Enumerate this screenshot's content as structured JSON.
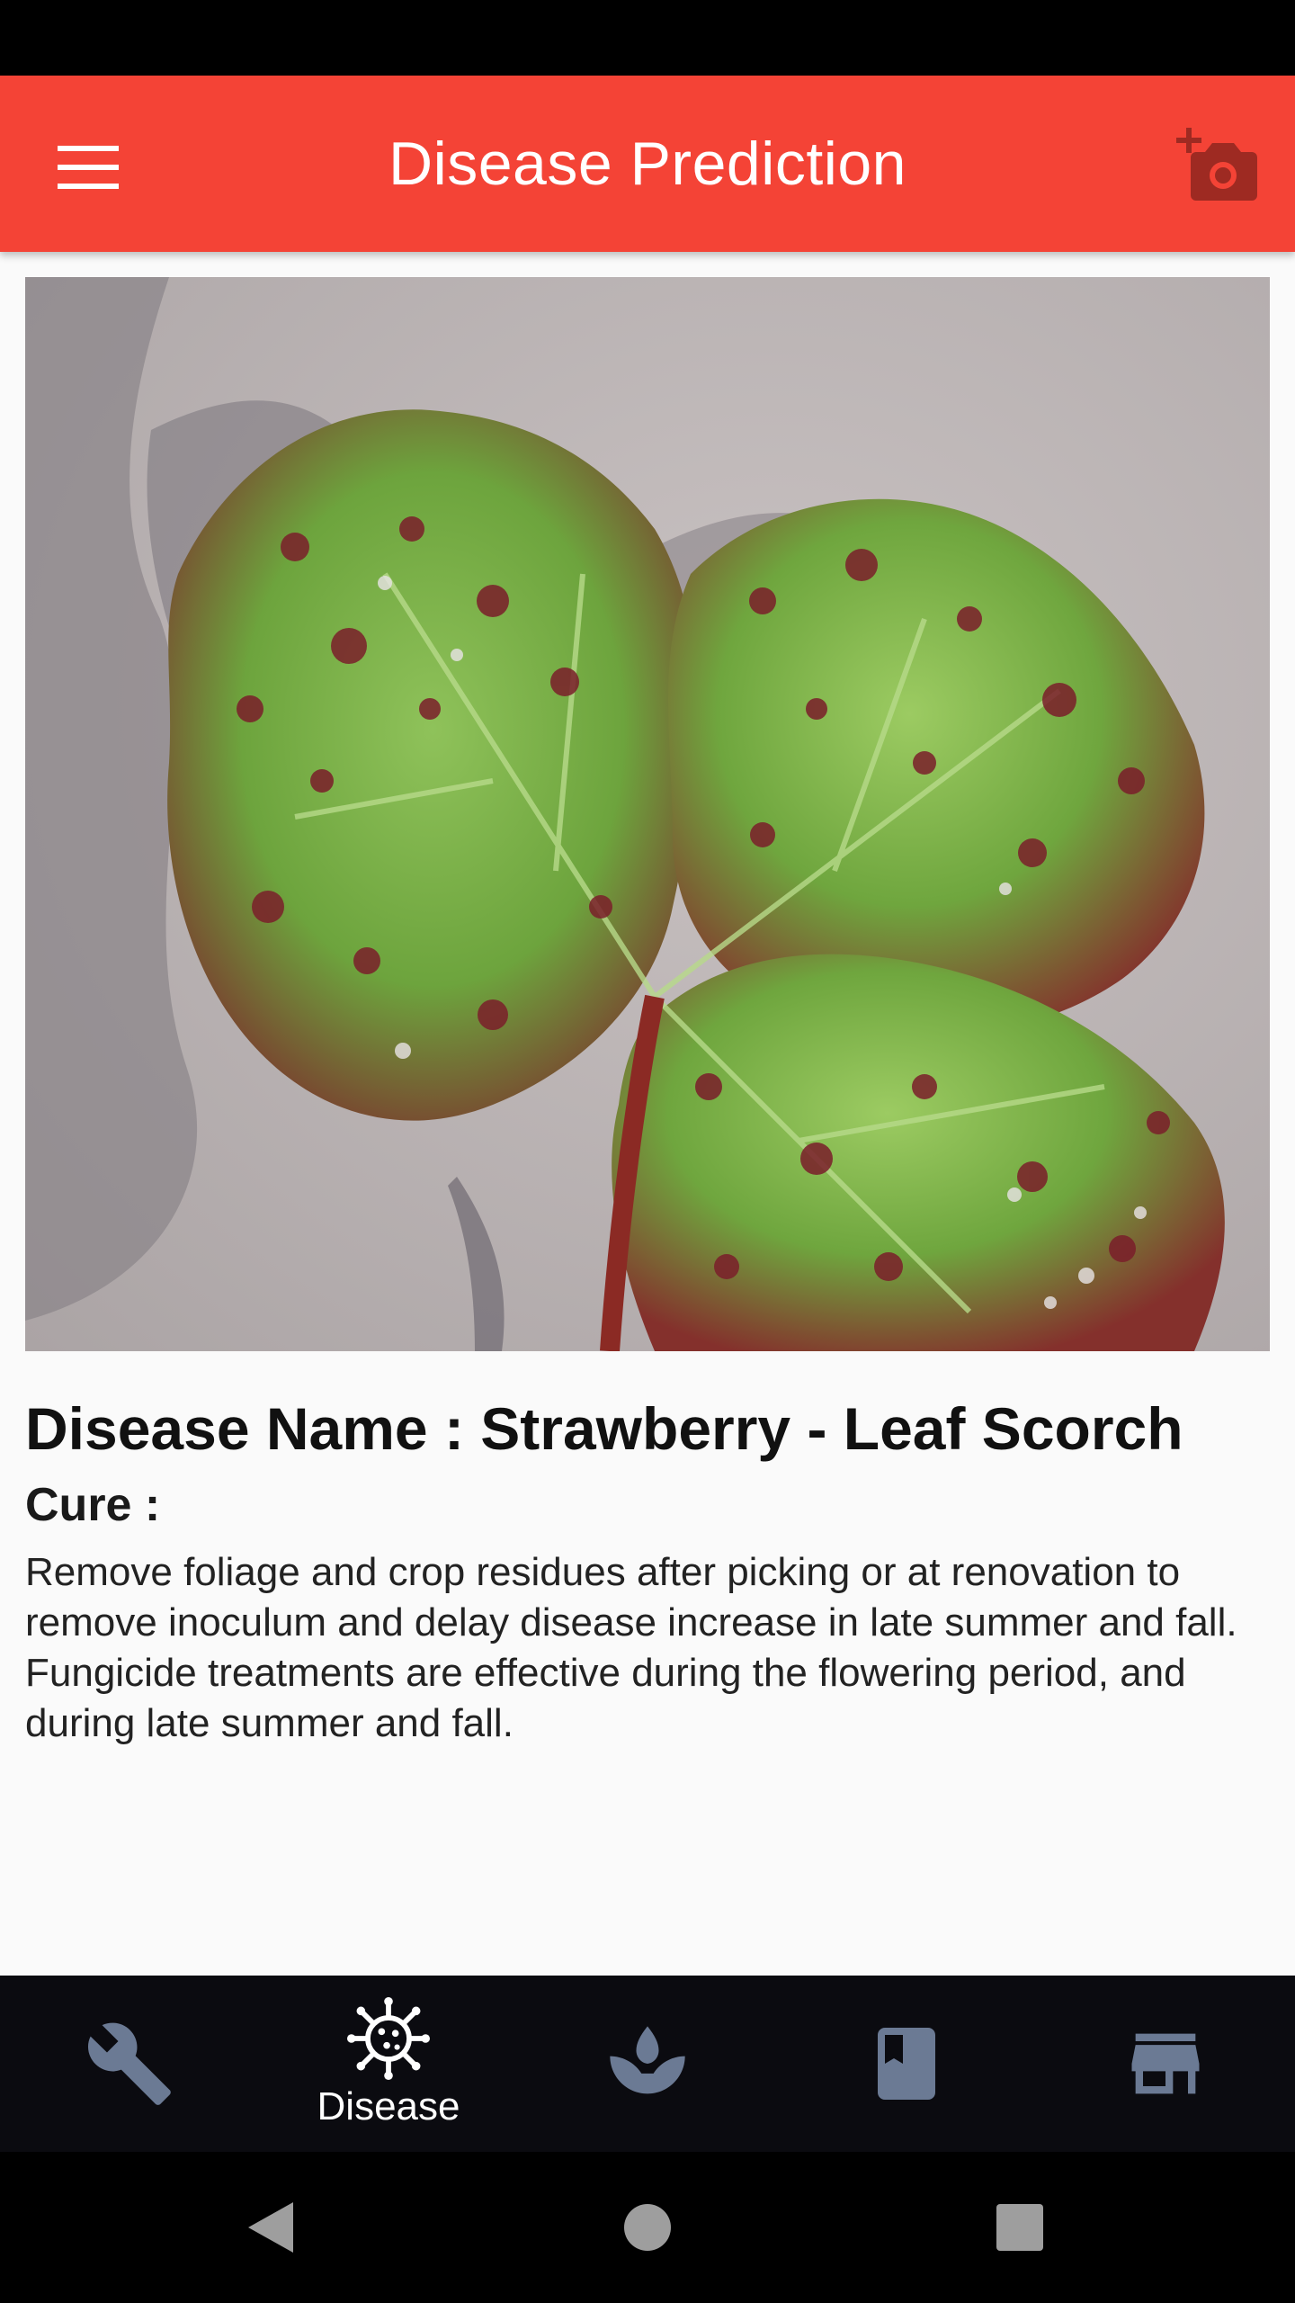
{
  "app_bar": {
    "title": "Disease Prediction",
    "menu_icon": "hamburger-menu-icon",
    "camera_icon": "add-a-photo-icon",
    "color": "#f44336"
  },
  "content": {
    "disease_name": "Disease Name : Strawberry - Leaf Scorch",
    "cure_label": "Cure :",
    "cure_text": "Remove foliage and crop residues after picking or at renovation to remove inoculum and delay disease increase in late summer and fall. Fungicide treatments are effective during the flowering period, and during late summer and fall."
  },
  "bottom_nav": {
    "items": [
      {
        "icon": "wrench-icon",
        "label": "",
        "active": false
      },
      {
        "icon": "virus-icon",
        "label": "Disease",
        "active": true
      },
      {
        "icon": "sprout-icon",
        "label": "",
        "active": false
      },
      {
        "icon": "book-icon",
        "label": "",
        "active": false
      },
      {
        "icon": "store-icon",
        "label": "",
        "active": false
      }
    ],
    "inactive_color": "#6b7a94",
    "active_color": "#ffffff"
  },
  "system_nav": {
    "icons": [
      "back-icon",
      "home-icon",
      "recents-icon"
    ]
  }
}
